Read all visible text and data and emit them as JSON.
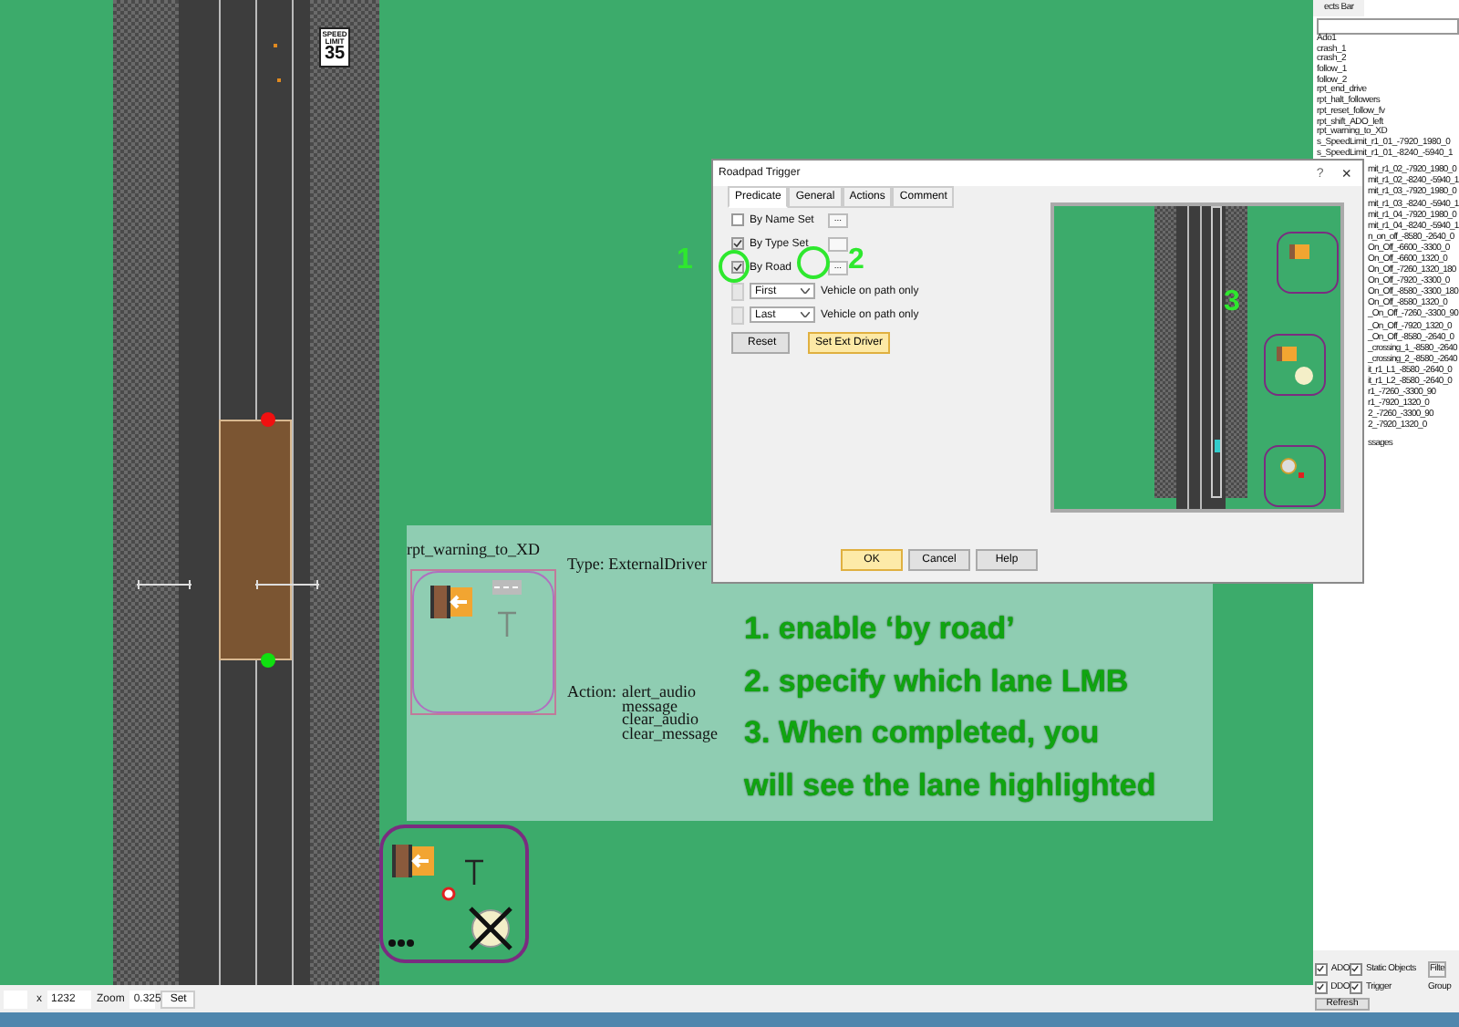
{
  "objects_panel": {
    "title": "ects Bar",
    "items": [
      "Ado1",
      "crash_1",
      "crash_2",
      "follow_1",
      "follow_2",
      "rpt_end_drive",
      "rpt_halt_followers",
      "rpt_reset_follow_fv",
      "rpt_shift_ADO_left",
      "rpt_warning_to_XD",
      "s_SpeedLimit_r1_01_-7920_1980_0",
      "s_SpeedLimit_r1_01_-8240_-5940_1"
    ],
    "items_behind_dialog": [
      "mit_r1_02_-7920_1980_0",
      "mit_r1_02_-8240_-5940_1",
      "mit_r1_03_-7920_1980_0",
      "mit_r1_03_-8240_-5940_1",
      "mit_r1_04_-7920_1980_0",
      "mit_r1_04_-8240_-5940_1",
      "n_on_off_-8580_-2640_0",
      "On_Off_-6600_-3300_0",
      "On_Off_-6600_1320_0",
      "On_Off_-7260_1320_180",
      "On_Off_-7920_-3300_0",
      "On_Off_-8580_-3300_180",
      "On_Off_-8580_1320_0",
      "_On_Off_-7260_-3300_90",
      "_On_Off_-7920_1320_0",
      "_On_Off_-8580_-2640_0",
      "_crossing_1_-8580_-2640",
      "_crossing_2_-8580_-2640",
      "it_r1_L1_-8580_-2640_0",
      "it_r1_L2_-8580_-2640_0",
      "r1_-7260_-3300_90",
      "r1_-7920_1320_0",
      "2_-7260_-3300_90",
      "2_-7920_1320_0"
    ],
    "footer_item": "ssages",
    "checkboxes": [
      {
        "label": "ADO",
        "checked": true
      },
      {
        "label": "Static Objects",
        "checked": true
      },
      {
        "label": "DDO",
        "checked": true
      },
      {
        "label": "Trigger",
        "checked": true
      }
    ],
    "filter_button": "Filte",
    "group_label": "Group",
    "refresh_button": "Refresh"
  },
  "canvas": {
    "speed_sign": {
      "line_1": "SPEED",
      "line_2": "LIMIT",
      "value": "35"
    },
    "trigger_info": {
      "name": "rpt_warning_to_XD",
      "type": "Type: ExternalDriver",
      "action_label": "Action:",
      "actions": [
        "alert_audio",
        "message",
        "clear_audio",
        "clear_message"
      ]
    },
    "instructions": [
      "1. enable ‘by road’",
      "2. specify which lane LMB",
      "3. When completed, you",
      "will see the lane highlighted"
    ]
  },
  "dialog": {
    "title": "Roadpad Trigger",
    "help": "?",
    "close": "×",
    "tabs": [
      {
        "label": "Predicate",
        "selected": true
      },
      {
        "label": "General",
        "selected": false
      },
      {
        "label": "Actions",
        "selected": false
      },
      {
        "label": "Comment",
        "selected": false
      }
    ],
    "predicates": [
      {
        "label": "By Name Set",
        "checked": false,
        "button": "..."
      },
      {
        "label": "By Type Set",
        "checked": true
      },
      {
        "label": "By Road",
        "checked": true,
        "button": "..."
      }
    ],
    "path_options": [
      {
        "value": "First",
        "note": "Vehicle on path only",
        "checked": false
      },
      {
        "value": "Last",
        "note": "Vehicle on path only",
        "checked": false
      }
    ],
    "reset_button": "Reset",
    "ext_driver_button": "Set Ext Driver",
    "footer_buttons": [
      {
        "label": "OK",
        "kind": "default"
      },
      {
        "label": "Cancel",
        "kind": "normal"
      },
      {
        "label": "Help",
        "kind": "normal"
      }
    ]
  },
  "annotations": [
    {
      "label": "1",
      "circled": true
    },
    {
      "label": "2",
      "circled": true
    },
    {
      "label": "3",
      "circled": false
    }
  ],
  "status_bar": {
    "x_label": "x",
    "x_value": "1232",
    "zoom_label": "Zoom",
    "zoom_value": "0.325",
    "set_button": "Set"
  }
}
